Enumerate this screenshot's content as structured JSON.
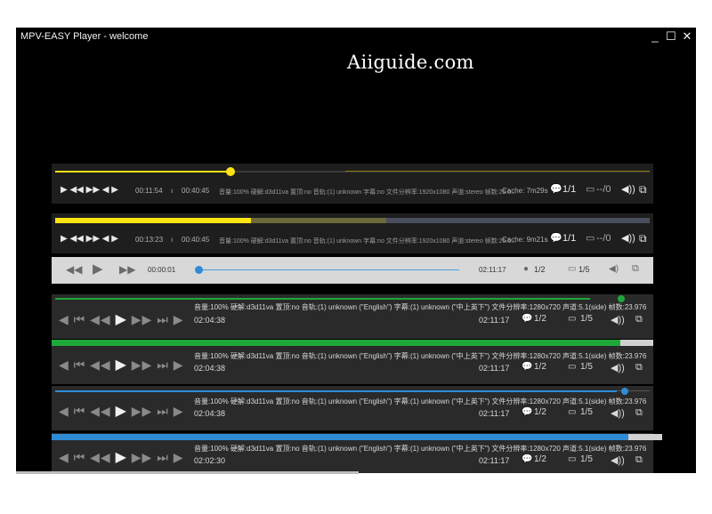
{
  "window": {
    "title": "MPV-EASY Player - welcome",
    "minimize": "_",
    "maximize": "☐",
    "close": "✕"
  },
  "watermark": "Aiiguide.com",
  "bars": [
    {
      "id": "bar1",
      "progress": 0.29,
      "time_current": "00:11:54",
      "time_total": "00:40:45",
      "info": "音量:100%  硬解:d3d11va  置顶:no  音轨:(1) unknown  字幕:no  文件分辨率:1920x1080  声道:stereo  帧数:25.0...",
      "cache": "Cache: 7m29s",
      "subs": "1/1",
      "tracks": "--/0"
    },
    {
      "id": "bar2",
      "progress": 0.33,
      "time_current": "00:13:23",
      "time_total": "00:40:45",
      "info": "音量:100%  硬解:d3d11va  置顶:no  音轨:(1) unknown  字幕:no  文件分辨率:1920x1080  声道:stereo  帧数:25.0...",
      "cache": "Cache: 9m21s",
      "subs": "1/1",
      "tracks": "--/0"
    },
    {
      "id": "bar3",
      "progress": 0.0,
      "time_current": "00:00:01",
      "time_total": "02:11:17",
      "subs": "1/2",
      "tracks": "1/5"
    },
    {
      "id": "bar4",
      "progress": 0.945,
      "info": "音量:100%  硬解:d3d11va  置顶:no  音轨:(1) unknown (\"English\")  字幕:(1) unknown (\"中上英下\")  文件分辨率:1280x720  声道:5.1(side)  帧数:23.976",
      "time_current": "02:04:38",
      "time_total": "02:11:17",
      "subs": "1/2",
      "tracks": "1/5",
      "color": "#1fa83a"
    },
    {
      "id": "bar5",
      "progress": 0.945,
      "info": "音量:100%  硬解:d3d11va  置顶:no  音轨:(1) unknown (\"English\")  字幕:(1) unknown (\"中上英下\")  文件分辨率:1280x720  声道:5.1(side)  帧数:23.976",
      "time_current": "02:04:38",
      "time_total": "02:11:17",
      "subs": "1/2",
      "tracks": "1/5",
      "color": "#1fa83a"
    },
    {
      "id": "bar6",
      "progress": 0.945,
      "info": "音量:100%  硬解:d3d11va  置顶:no  音轨:(1) unknown (\"English\")  字幕:(1) unknown (\"中上英下\")  文件分辨率:1280x720  声道:5.1(side)  帧数:23.976",
      "time_current": "02:04:38",
      "time_total": "02:11:17",
      "subs": "1/2",
      "tracks": "1/5",
      "color": "#2e8bd6"
    },
    {
      "id": "bar7",
      "progress": 0.945,
      "info": "音量:100%  硬解:d3d11va  置顶:no  音轨:(1) unknown (\"English\")  字幕:(1) unknown (\"中上英下\")  文件分辨率:1280x720  声道:5.1(side)  帧数:23.976",
      "time_current": "02:02:30",
      "time_total": "02:11:17",
      "subs": "1/2",
      "tracks": "1/5",
      "color": "#2e8bd6"
    }
  ],
  "colors": {
    "yellow": "#ffe414",
    "green": "#1fa83a",
    "blue": "#2e8bd6"
  },
  "icons": {
    "play": "play-icon",
    "prev": "previous-icon",
    "next": "next-icon",
    "rewind": "rewind-icon",
    "forward": "fast-forward-icon",
    "subtitle": "subtitle-icon",
    "track": "track-icon",
    "volume": "volume-icon",
    "screen": "screen-icon"
  }
}
